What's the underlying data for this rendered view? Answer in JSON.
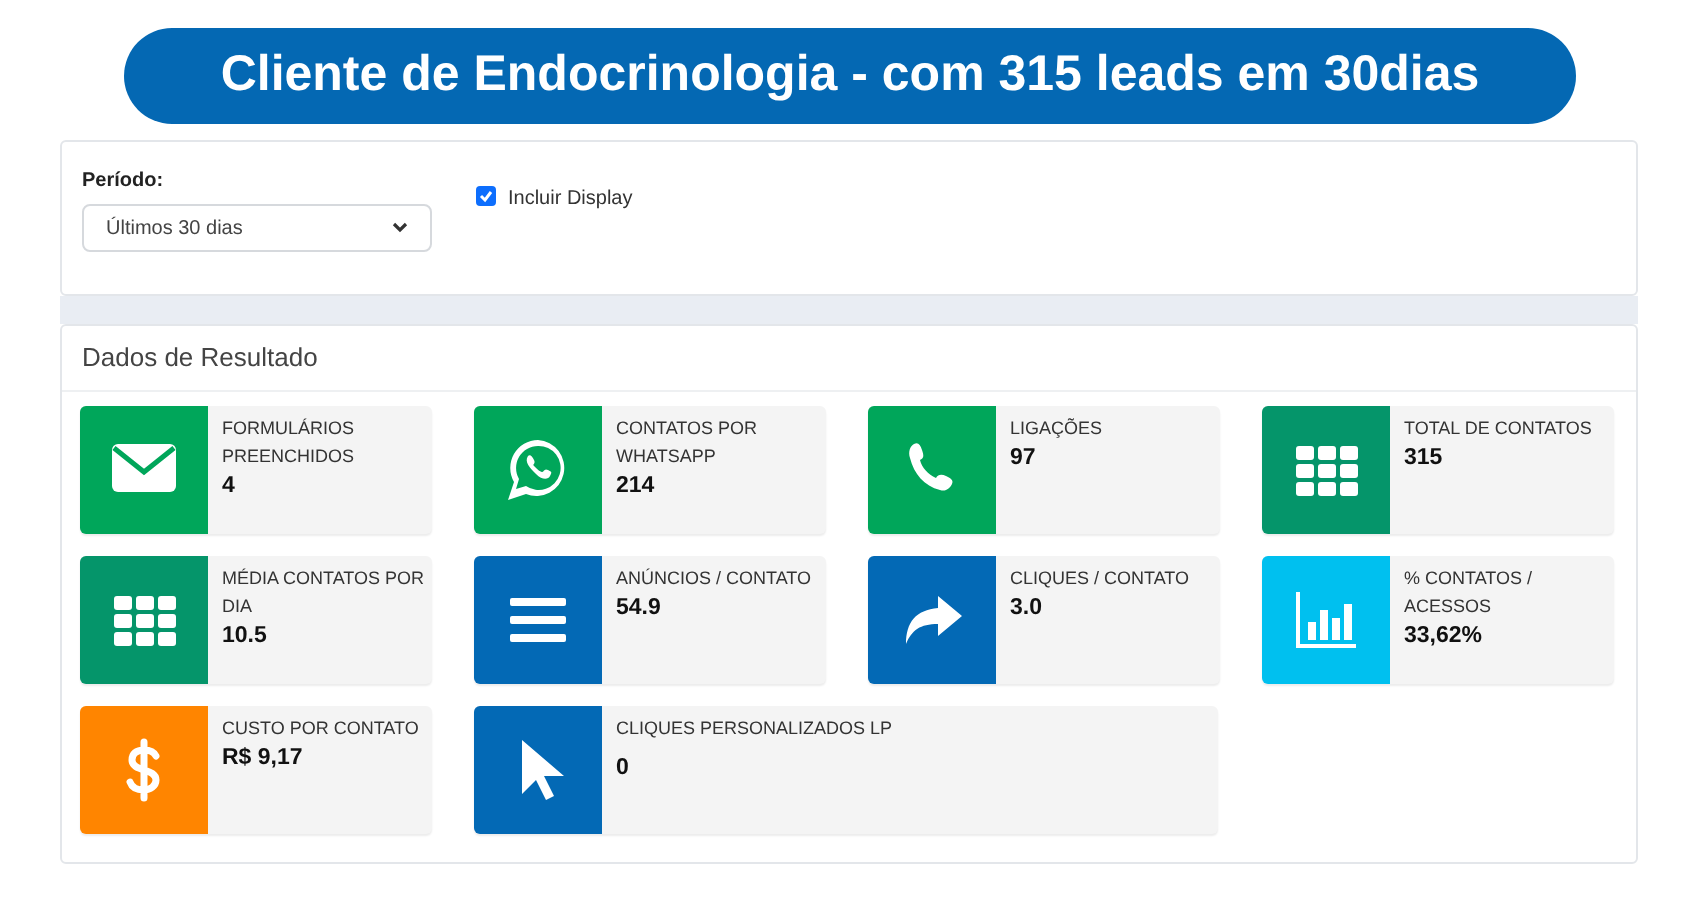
{
  "banner": {
    "title": "Cliente de Endocrinologia - com 315 leads em 30dias"
  },
  "filters": {
    "period_label": "Período:",
    "period_value": "Últimos 30 dias",
    "include_display": {
      "label": "Incluir Display",
      "checked": true
    }
  },
  "results": {
    "title": "Dados de Resultado",
    "cards": [
      {
        "label": "FORMULÁRIOS PREENCHIDOS",
        "value": "4",
        "color": "#00a65a"
      },
      {
        "label": "CONTATOS POR WHATSAPP",
        "value": "214",
        "color": "#00a65a"
      },
      {
        "label": "LIGAÇÕES",
        "value": "97",
        "color": "#00a65a"
      },
      {
        "label": "TOTAL DE CONTATOS",
        "value": "315",
        "color": "#05956a"
      },
      {
        "label": "MÉDIA CONTATOS POR DIA",
        "value": "10.5",
        "color": "#05956a"
      },
      {
        "label": "ANÚNCIOS / CONTATO",
        "value": "54.9",
        "color": "#0369b5"
      },
      {
        "label": "CLIQUES / CONTATO",
        "value": "3.0",
        "color": "#0369b5"
      },
      {
        "label": "% CONTATOS / ACESSOS",
        "value": "33,62%",
        "color": "#00c0ef"
      },
      {
        "label": "CUSTO POR CONTATO",
        "value": "R$ 9,17",
        "color": "#ff8500"
      },
      {
        "label": "CLIQUES PERSONALIZADOS LP",
        "value": "0",
        "color": "#0369b5"
      }
    ]
  }
}
